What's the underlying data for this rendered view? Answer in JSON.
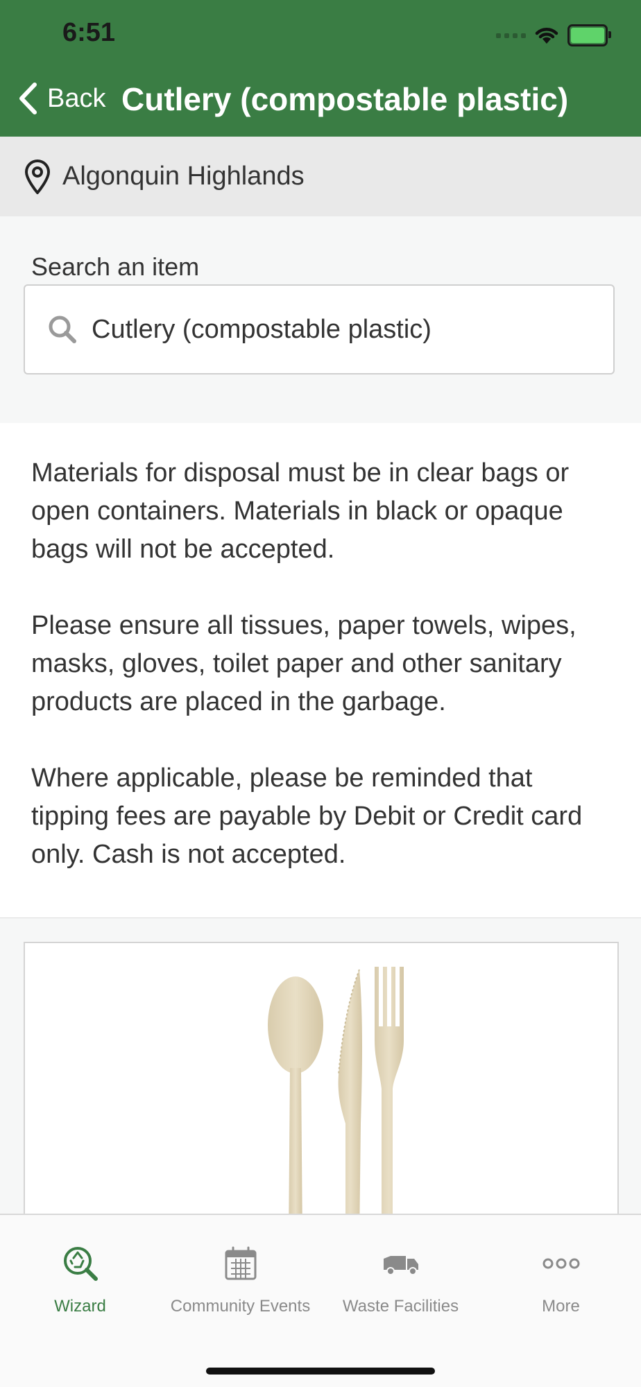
{
  "status_bar": {
    "time": "6:51"
  },
  "nav": {
    "back_label": "Back",
    "title": "Cutlery (compostable plastic)"
  },
  "location": {
    "name": "Algonquin Highlands",
    "icon": "map-pin-icon"
  },
  "search": {
    "label": "Search an item",
    "value": "Cutlery (compostable plastic)",
    "icon": "search-icon"
  },
  "info_paragraphs": [
    "Materials for disposal must be in clear bags or open containers. Materials in black or opaque bags will not be accepted.",
    "Please ensure all tissues, paper towels, wipes, masks, gloves, toilet paper and other sanitary products are placed in the garbage.",
    "Where applicable, please be reminded that tipping fees are payable by Debit or Credit card only.  Cash is not accepted."
  ],
  "item_image": {
    "icon": "cutlery-image"
  },
  "tabs": [
    {
      "label": "Wizard",
      "icon": "recycle-search-icon",
      "active": true
    },
    {
      "label": "Community Events",
      "icon": "calendar-icon",
      "active": false
    },
    {
      "label": "Waste Facilities",
      "icon": "truck-icon",
      "active": false
    },
    {
      "label": "More",
      "icon": "more-dots-icon",
      "active": false
    }
  ],
  "colors": {
    "brand_green": "#3a7d44",
    "header_green": "#3a7d44",
    "inactive_gray": "#8a8a8a"
  }
}
